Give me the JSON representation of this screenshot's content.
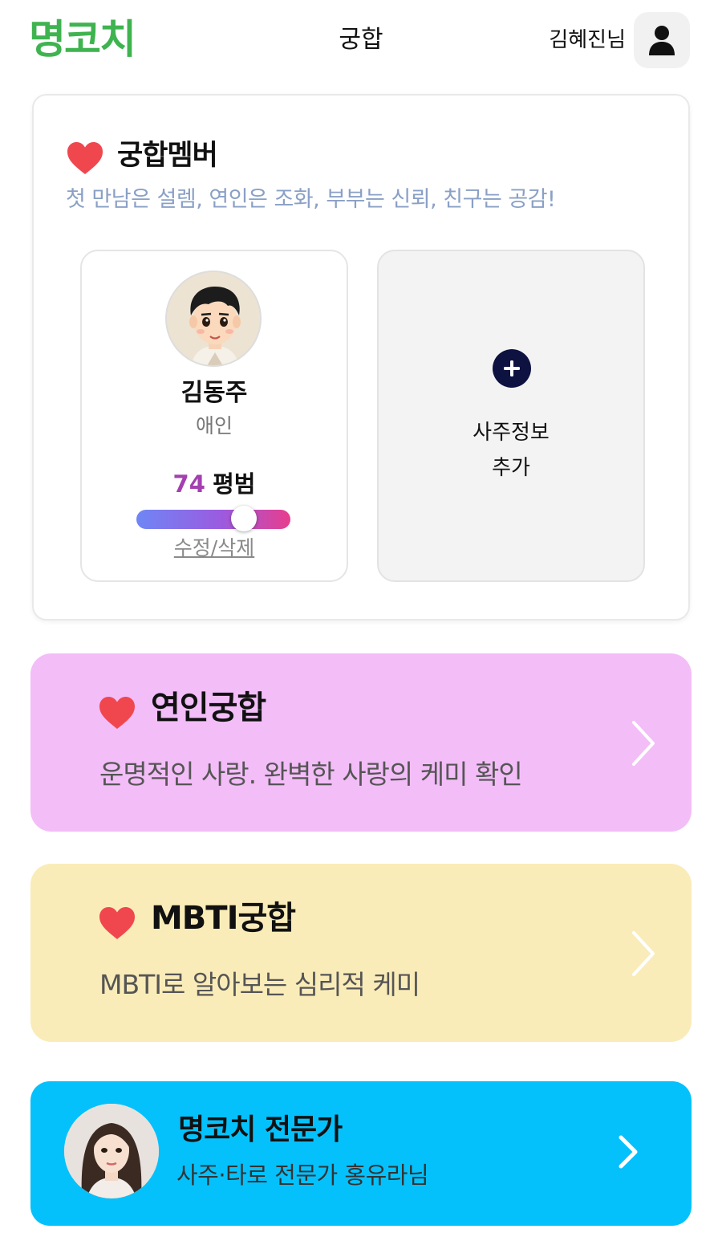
{
  "header": {
    "logo": "명코치",
    "title": "궁합",
    "user_name": "김혜진님",
    "user_icon": "person-icon"
  },
  "members": {
    "title": "궁합멤버",
    "subtitle": "첫 만남은 설렘, 연인은 조화, 부부는 신뢰, 친구는 공감!",
    "heart_icon": "heart-icon",
    "person": {
      "name": "김동주",
      "relation": "애인",
      "score": "74",
      "score_label": "평범",
      "score_fraction": 0.74,
      "edit_label": "수정/삭제"
    },
    "add": {
      "icon": "plus-circle-icon",
      "label_line1": "사주정보",
      "label_line2": "추가"
    }
  },
  "love": {
    "title": "연인궁합",
    "subtitle": "운명적인 사랑. 완벽한 사랑의 케미 확인",
    "background": "#f3bdf8"
  },
  "mbti": {
    "title": "MBTI궁합",
    "subtitle": "MBTI로 알아보는 심리적 케미",
    "background": "#faecb8"
  },
  "expert": {
    "title": "명코치 전문가",
    "subtitle": "사주·타로 전문가 홍유라님",
    "background": "#05c1fb"
  },
  "colors": {
    "brand_green": "#3fb34f",
    "heart_red": "#f0474f",
    "score_purple": "#a43fb0",
    "subtitle_blue": "#8aa0c6"
  }
}
